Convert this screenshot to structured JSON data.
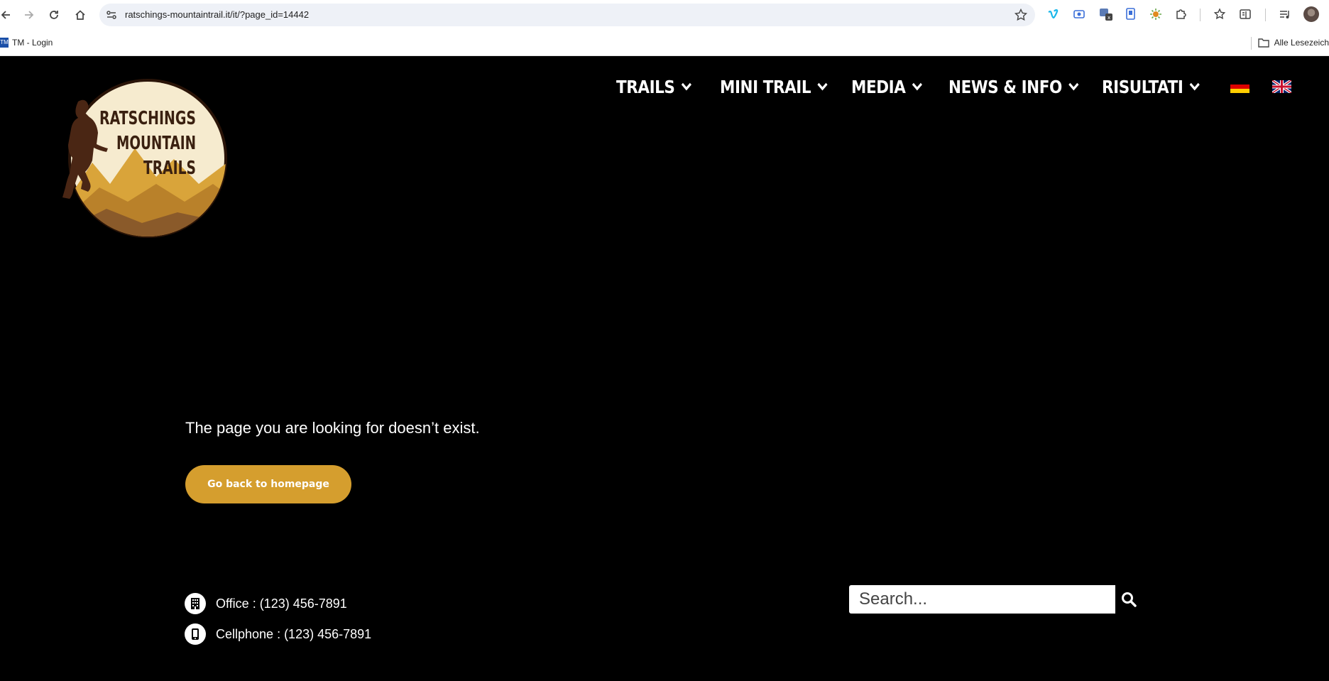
{
  "browser": {
    "url": "ratschings-mountaintrail.it/it/?page_id=14442",
    "bookmark_left": "TM - Login",
    "bookmark_left_favicon": "TM",
    "bookmark_right": "Alle Lesezeich"
  },
  "nav": {
    "items": [
      "TRAILS",
      "MINI TRAIL",
      "MEDIA",
      "NEWS & INFO",
      "RISULTATI"
    ]
  },
  "logo": {
    "line1": "RATSCHINGS",
    "line2": "MOUNTAIN",
    "line3": "TRAILS"
  },
  "content": {
    "message": "The page you are looking for doesn’t exist.",
    "button": "Go back to homepage"
  },
  "footer": {
    "office": "Office : (123) 456-7891",
    "cellphone": "Cellphone : (123) 456-7891",
    "search_placeholder": "Search..."
  },
  "colors": {
    "accent": "#d59e2e",
    "background": "#000000"
  }
}
